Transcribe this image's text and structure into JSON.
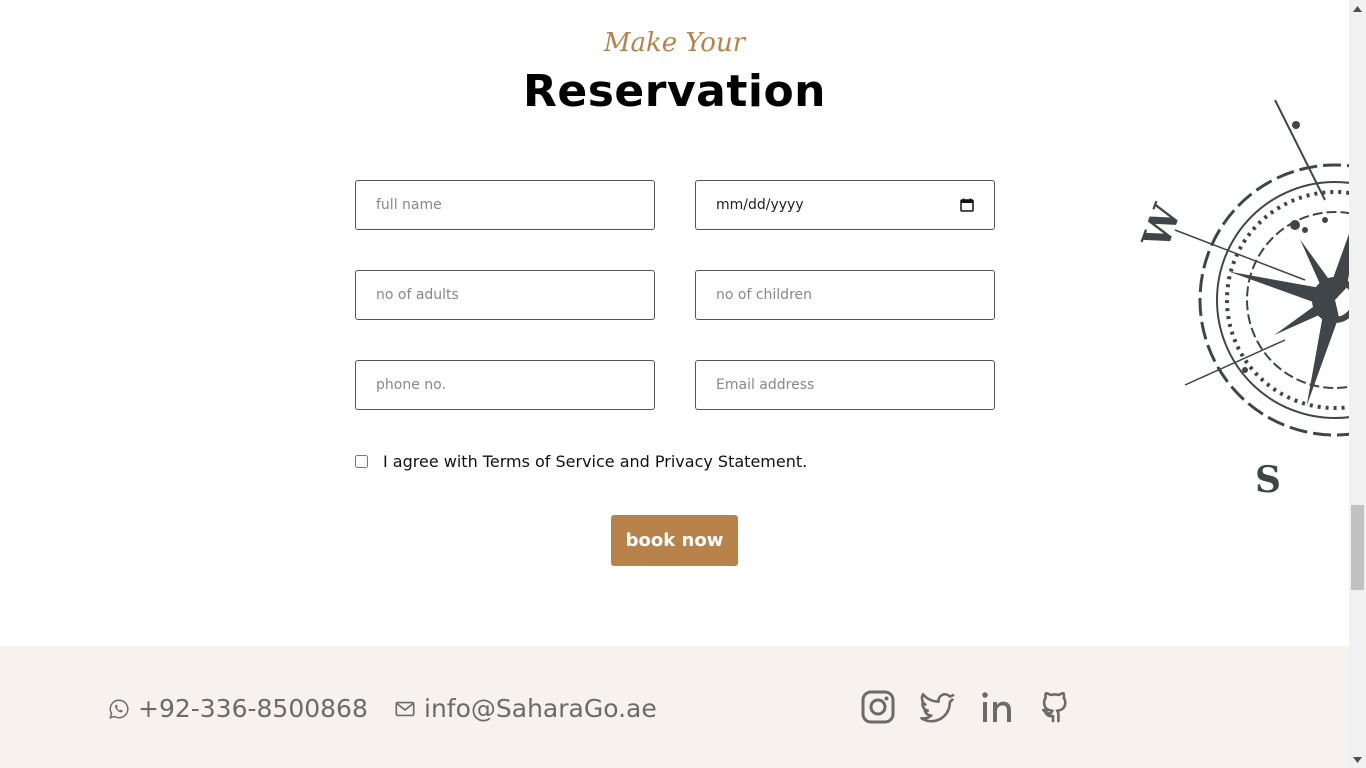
{
  "section": {
    "kicker": "Make Your",
    "title": "Reservation"
  },
  "form": {
    "full_name_placeholder": "full name",
    "date_placeholder": "mm/dd/yyyy",
    "adults_placeholder": "no of adults",
    "children_placeholder": "no of children",
    "phone_placeholder": "phone no.",
    "email_placeholder": "Email address",
    "agree_label": "I agree with Terms of Service and Privacy Statement.",
    "agree_checked": false,
    "submit_label": "book now"
  },
  "footer": {
    "phone": "+92-336-8500868",
    "email": "info@SaharaGo.ae",
    "socials": [
      "instagram-icon",
      "twitter-icon",
      "linkedin-icon",
      "github-icon"
    ]
  },
  "colors": {
    "accent": "#b8834a",
    "footer_bg": "#f7f2ee",
    "muted_text": "#6b6b6b"
  }
}
